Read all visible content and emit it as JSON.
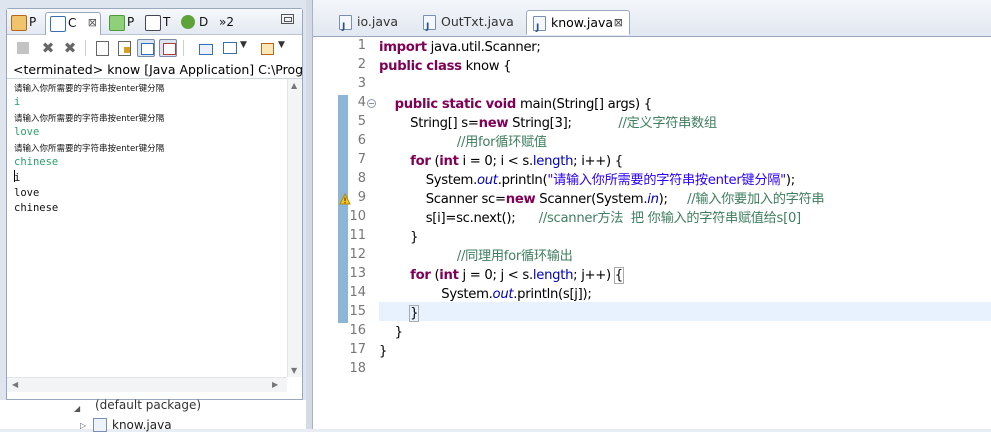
{
  "left_tabs": [
    {
      "label": "P",
      "icon": "package-explorer-icon",
      "color": "#d9534f"
    },
    {
      "label": "C",
      "icon": "console-icon",
      "color": "#3b6db3",
      "active": true
    },
    {
      "label": "P",
      "icon": "progress-icon",
      "color": "#4c9a3c"
    },
    {
      "label": "T",
      "icon": "task-icon",
      "color": "#445"
    },
    {
      "label": "D",
      "icon": "debug-icon",
      "color": "#4f8a2f"
    },
    {
      "label": "»2",
      "icon": "overflow-icon",
      "color": "#333"
    }
  ],
  "console": {
    "terminated_text": "<terminated> know [Java Application] C:\\Progra",
    "lines": [
      {
        "text": "请输入你所需要的字符串按enter键分隔",
        "style": "prompt"
      },
      {
        "text": "i",
        "style": "green"
      },
      {
        "text": "请输入你所需要的字符串按enter键分隔",
        "style": "prompt"
      },
      {
        "text": "love",
        "style": "green"
      },
      {
        "text": "请输入你所需要的字符串按enter键分隔",
        "style": "prompt"
      },
      {
        "text": "chinese",
        "style": "green"
      },
      {
        "text": "i",
        "style": "black"
      },
      {
        "text": "love",
        "style": "black"
      },
      {
        "text": "chinese",
        "style": "black"
      }
    ]
  },
  "tree": {
    "package_label": "(default package)",
    "file_label": "know.java"
  },
  "editor_tabs": [
    {
      "label": "io.java"
    },
    {
      "label": "OutTxt.java"
    },
    {
      "label": "know.java",
      "active": true
    }
  ],
  "close_glyph": "⊠",
  "line_numbers": [
    "1",
    "2",
    "3",
    "4",
    "5",
    "6",
    "7",
    "8",
    "9",
    "10",
    "11",
    "12",
    "13",
    "14",
    "15",
    "16",
    "17",
    "18"
  ],
  "code": [
    [
      {
        "t": "import",
        "c": "kw"
      },
      {
        "t": " java.util.Scanner;"
      }
    ],
    [
      {
        "t": "public",
        "c": "kw"
      },
      {
        "t": " "
      },
      {
        "t": "class",
        "c": "kw"
      },
      {
        "t": " know {"
      }
    ],
    [],
    [
      {
        "t": "    "
      },
      {
        "t": "public",
        "c": "kw"
      },
      {
        "t": " "
      },
      {
        "t": "static",
        "c": "kw"
      },
      {
        "t": " "
      },
      {
        "t": "void",
        "c": "kw"
      },
      {
        "t": " main(String[] args) {"
      }
    ],
    [
      {
        "t": "        String[] s="
      },
      {
        "t": "new",
        "c": "kw"
      },
      {
        "t": " String[3];            "
      },
      {
        "t": "//定义字符串数组",
        "c": "cm"
      }
    ],
    [
      {
        "t": "                    "
      },
      {
        "t": "//用for循环赋值",
        "c": "cm"
      }
    ],
    [
      {
        "t": "        "
      },
      {
        "t": "for",
        "c": "kw"
      },
      {
        "t": " ("
      },
      {
        "t": "int",
        "c": "kw"
      },
      {
        "t": " i = 0; i < s."
      },
      {
        "t": "length",
        "c": "fd"
      },
      {
        "t": "; i++) {"
      }
    ],
    [
      {
        "t": "            System."
      },
      {
        "t": "out",
        "c": "fdi"
      },
      {
        "t": ".println("
      },
      {
        "t": "\"请输入你所需要的字符串按enter键分隔\"",
        "c": "st"
      },
      {
        "t": ");"
      }
    ],
    [
      {
        "t": "            Scanner sc="
      },
      {
        "t": "new",
        "c": "kw"
      },
      {
        "t": " Scanner(System."
      },
      {
        "t": "in",
        "c": "fdi"
      },
      {
        "t": ");     "
      },
      {
        "t": "//输入你要加入的字符串",
        "c": "cm"
      }
    ],
    [
      {
        "t": "            s[i]=sc.next();      "
      },
      {
        "t": "//scanner方法  把 你输入的字符串赋值给s[0]",
        "c": "cm"
      }
    ],
    [
      {
        "t": "        }"
      }
    ],
    [
      {
        "t": "                    "
      },
      {
        "t": "//同理用for循环输出",
        "c": "cm"
      }
    ],
    [
      {
        "t": "        "
      },
      {
        "t": "for",
        "c": "kw"
      },
      {
        "t": " ("
      },
      {
        "t": "int",
        "c": "kw"
      },
      {
        "t": " j = 0; j < s."
      },
      {
        "t": "length",
        "c": "fd"
      },
      {
        "t": "; j++) "
      },
      {
        "t": "{",
        "c": "bx"
      }
    ],
    [
      {
        "t": "                System."
      },
      {
        "t": "out",
        "c": "fdi"
      },
      {
        "t": ".println(s[j]);"
      }
    ],
    [
      {
        "t": "        "
      },
      {
        "t": "}",
        "c": "bx"
      }
    ],
    [
      {
        "t": "    }"
      }
    ],
    [
      {
        "t": "}"
      }
    ],
    []
  ]
}
